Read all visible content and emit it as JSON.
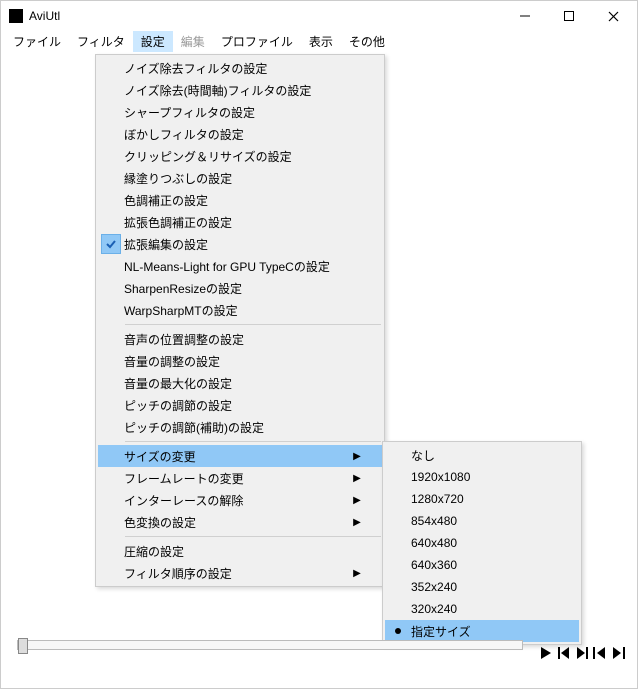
{
  "title": "AviUtl",
  "menubar": {
    "items": [
      {
        "label": "ファイル",
        "state": "normal"
      },
      {
        "label": "フィルタ",
        "state": "normal"
      },
      {
        "label": "設定",
        "state": "active"
      },
      {
        "label": "編集",
        "state": "disabled"
      },
      {
        "label": "プロファイル",
        "state": "normal"
      },
      {
        "label": "表示",
        "state": "normal"
      },
      {
        "label": "その他",
        "state": "normal"
      }
    ]
  },
  "menu": {
    "sections": [
      [
        {
          "label": "ノイズ除去フィルタの設定"
        },
        {
          "label": "ノイズ除去(時間軸)フィルタの設定"
        },
        {
          "label": "シャープフィルタの設定"
        },
        {
          "label": "ぼかしフィルタの設定"
        },
        {
          "label": "クリッピング＆リサイズの設定"
        },
        {
          "label": "縁塗りつぶしの設定"
        },
        {
          "label": "色調補正の設定"
        },
        {
          "label": "拡張色調補正の設定"
        },
        {
          "label": "拡張編集の設定",
          "checked": true
        },
        {
          "label": "NL-Means-Light for GPU TypeCの設定"
        },
        {
          "label": "SharpenResizeの設定"
        },
        {
          "label": "WarpSharpMTの設定"
        }
      ],
      [
        {
          "label": "音声の位置調整の設定"
        },
        {
          "label": "音量の調整の設定"
        },
        {
          "label": "音量の最大化の設定"
        },
        {
          "label": "ピッチの調節の設定"
        },
        {
          "label": "ピッチの調節(補助)の設定"
        }
      ],
      [
        {
          "label": "サイズの変更",
          "submenu": true,
          "highlight": true
        },
        {
          "label": "フレームレートの変更",
          "submenu": true
        },
        {
          "label": "インターレースの解除",
          "submenu": true
        },
        {
          "label": "色変換の設定",
          "submenu": true
        }
      ],
      [
        {
          "label": "圧縮の設定"
        },
        {
          "label": "フィルタ順序の設定",
          "submenu": true
        }
      ]
    ]
  },
  "submenu": {
    "items": [
      {
        "label": "なし"
      },
      {
        "label": "1920x1080"
      },
      {
        "label": "1280x720"
      },
      {
        "label": "854x480"
      },
      {
        "label": "640x480"
      },
      {
        "label": "640x360"
      },
      {
        "label": "352x240"
      },
      {
        "label": "320x240"
      },
      {
        "label": "指定サイズ",
        "selected": true,
        "highlight": true
      }
    ]
  },
  "icons": {
    "check": "✓"
  }
}
